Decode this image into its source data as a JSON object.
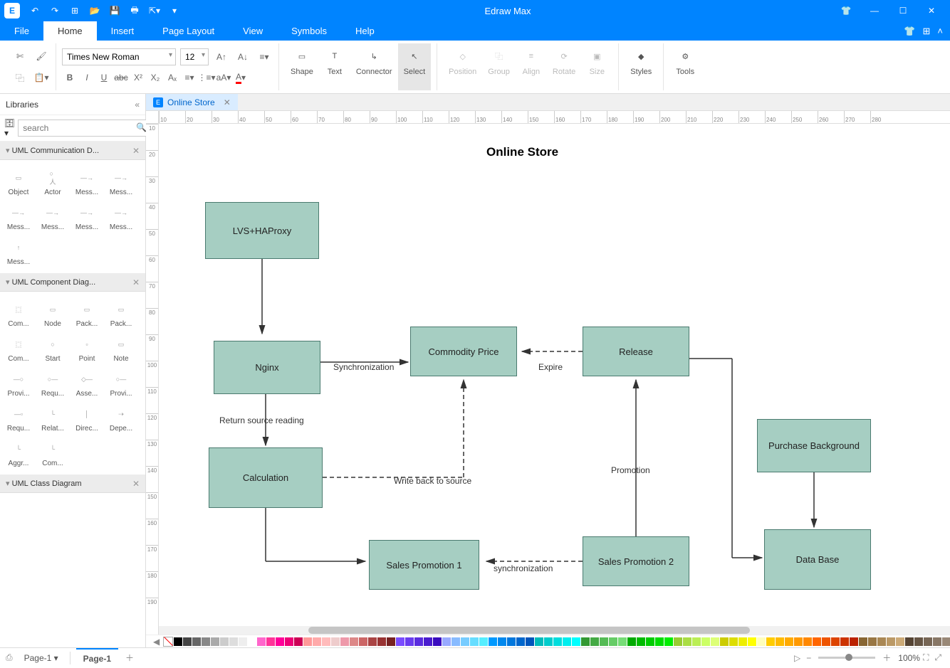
{
  "app": {
    "title": "Edraw Max"
  },
  "menus": {
    "file": "File",
    "home": "Home",
    "insert": "Insert",
    "page_layout": "Page Layout",
    "view": "View",
    "symbols": "Symbols",
    "help": "Help"
  },
  "ribbon": {
    "font_name": "Times New Roman",
    "font_size": "12",
    "shape": "Shape",
    "text": "Text",
    "connector": "Connector",
    "select": "Select",
    "position": "Position",
    "group": "Group",
    "align": "Align",
    "rotate": "Rotate",
    "size": "Size",
    "styles": "Styles",
    "tools": "Tools"
  },
  "libraries": {
    "title": "Libraries",
    "search_placeholder": "search",
    "cat1": "UML Communication D...",
    "cat1_items": [
      "Object",
      "Actor",
      "Mess...",
      "Mess...",
      "Mess...",
      "Mess...",
      "Mess...",
      "Mess...",
      "Mess..."
    ],
    "cat2": "UML Component Diag...",
    "cat2_items": [
      "Com...",
      "Node",
      "Pack...",
      "Pack...",
      "Com...",
      "Start",
      "Point",
      "Note",
      "Provi...",
      "Requ...",
      "Asse...",
      "Provi...",
      "Requ...",
      "Relat...",
      "Direc...",
      "Depe...",
      "Aggr...",
      "Com..."
    ],
    "cat3": "UML Class Diagram"
  },
  "doc_tab": "Online Store",
  "diagram": {
    "title": "Online Store",
    "nodes": {
      "lvs": "LVS+HAProxy",
      "nginx": "Nginx",
      "commodity": "Commodity Price",
      "release": "Release",
      "calculation": "Calculation",
      "promo1": "Sales Promotion 1",
      "promo2": "Sales Promotion 2",
      "purchase": "Purchase Background",
      "database": "Data Base"
    },
    "labels": {
      "sync1": "Synchronization",
      "expire": "Expire",
      "return_src": "Return source reading",
      "writeback": "Write back to source",
      "promotion": "Promotion",
      "sync2": "synchronization"
    }
  },
  "ruler_h": [
    "10",
    "20",
    "30",
    "40",
    "50",
    "60",
    "70",
    "80",
    "90",
    "100",
    "110",
    "120",
    "130",
    "140",
    "150",
    "160",
    "170",
    "180",
    "190",
    "200",
    "210",
    "220",
    "230",
    "240",
    "250",
    "260",
    "270",
    "280"
  ],
  "ruler_v": [
    "10",
    "20",
    "30",
    "40",
    "50",
    "60",
    "70",
    "80",
    "90",
    "100",
    "110",
    "120",
    "130",
    "140",
    "150",
    "160",
    "170",
    "180",
    "190"
  ],
  "status": {
    "page_select": "Page-1",
    "page_tab": "Page-1",
    "zoom": "100%"
  },
  "swatches": [
    "#000",
    "#444",
    "#666",
    "#888",
    "#aaa",
    "#ccc",
    "#ddd",
    "#eee",
    "#fff",
    "#f6c",
    "#f39",
    "#f09",
    "#e07",
    "#c05",
    "#f99",
    "#faa",
    "#fbb",
    "#ecc",
    "#e9a",
    "#d88",
    "#c66",
    "#a44",
    "#933",
    "#722",
    "#7a4cff",
    "#6a3cef",
    "#5a2cdf",
    "#4a1ccf",
    "#3a0cbf",
    "#9af",
    "#8bf",
    "#7cf",
    "#6df",
    "#5ef",
    "#09f",
    "#08e",
    "#07d",
    "#06c",
    "#05b",
    "#0bb",
    "#0cc",
    "#0dd",
    "#0ee",
    "#0ff",
    "#393",
    "#4a4",
    "#5b5",
    "#6c6",
    "#7d7",
    "#0a0",
    "#0b0",
    "#0c0",
    "#0d0",
    "#0e0",
    "#9c3",
    "#ad4",
    "#be5",
    "#cf6",
    "#df7",
    "#cc0",
    "#dd0",
    "#ee0",
    "#ff0",
    "#ffb",
    "#fc0",
    "#fb0",
    "#fa0",
    "#f90",
    "#f80",
    "#f60",
    "#e50",
    "#d40",
    "#c30",
    "#b20",
    "#863",
    "#974",
    "#a85",
    "#b96",
    "#ca7",
    "#543",
    "#654",
    "#765",
    "#876",
    "#987"
  ]
}
